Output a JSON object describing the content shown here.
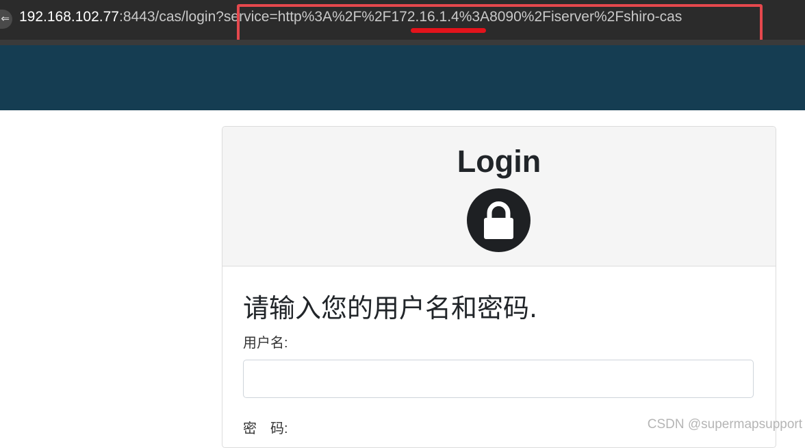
{
  "browser": {
    "site_info_icon": "page-info-icon",
    "url_host": "192.168.102.77",
    "url_rest": ":8443/cas/login?service=http%3A%2F%2F172.16.1.4%3A8090%2Fiserver%2Fshiro-cas"
  },
  "colors": {
    "header_band": "#153d52",
    "highlight": "#e5484d"
  },
  "login": {
    "title": "Login",
    "icon": "lock-icon",
    "prompt": "请输入您的用户名和密码.",
    "username_label": "用户名:",
    "username_value": "",
    "password_label": "密　码:"
  },
  "watermark": "CSDN @supermapsupport"
}
